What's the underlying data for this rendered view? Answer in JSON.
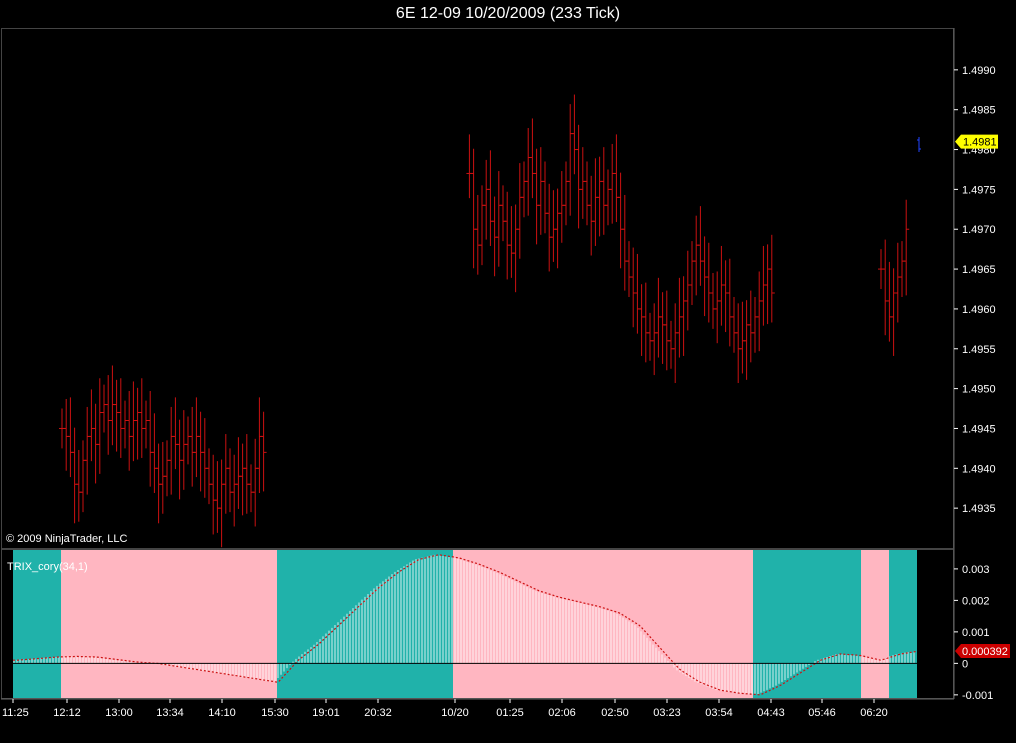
{
  "title": "6E 12-09  10/20/2009 (233 Tick)",
  "copyright": "© 2009 NinjaTrader, LLC",
  "indicator_label": "TRIX_cory(34,1)",
  "colors": {
    "background": "#000000",
    "price_bars": "#cc1111",
    "last_price_marker": "#ffff00",
    "trix_bars": "#ffffff",
    "trix_signal_line": "#cc1111",
    "zone_teal": "#20b2aa",
    "zone_pink": "#ffb6c1",
    "current_trix_marker": "#cc0000"
  },
  "chart_data": [
    {
      "type": "ohlc",
      "name": "price",
      "ylim": [
        1.493,
        1.4995
      ],
      "yticks": [
        "1.4935",
        "1.4940",
        "1.4945",
        "1.4950",
        "1.4955",
        "1.4960",
        "1.4965",
        "1.4970",
        "1.4975",
        "1.4980",
        "1.4985",
        "1.4990"
      ],
      "last_price": "1.4981",
      "segments": [
        {
          "start_bar": 0,
          "closes": [
            1.4945,
            1.4944,
            1.4942,
            1.4938,
            1.4937,
            1.4941,
            1.4944,
            1.4945,
            1.4943,
            1.4947,
            1.4948,
            1.4946,
            1.4948,
            1.4947,
            1.4945,
            1.4946,
            1.4944,
            1.4946,
            1.4947,
            1.4945,
            1.4946,
            1.4942,
            1.494,
            1.4938,
            1.4939,
            1.4941,
            1.4944,
            1.4943,
            1.4941,
            1.4943,
            1.4944,
            1.4942,
            1.4944,
            1.4942,
            1.494,
            1.4938,
            1.4936,
            1.4935,
            1.4938,
            1.494,
            1.4937,
            1.4938,
            1.4939,
            1.494,
            1.4938,
            1.4937,
            1.494,
            1.4944,
            1.4942
          ]
        },
        {
          "start_bar": 97,
          "closes": [
            1.4977,
            1.497,
            1.4968,
            1.4973,
            1.4975,
            1.4971,
            1.4969,
            1.4973,
            1.4971,
            1.4968,
            1.4967,
            1.497,
            1.4974,
            1.4976,
            1.4979,
            1.4977,
            1.4973,
            1.4976,
            1.4972,
            1.4969,
            1.497,
            1.4972,
            1.4973,
            1.4976,
            1.4982,
            1.498,
            1.4975,
            1.4976,
            1.4973,
            1.4971,
            1.4974,
            1.4976,
            1.4973,
            1.4975,
            1.4977,
            1.4974,
            1.497,
            1.4966,
            1.4964,
            1.4962,
            1.496,
            1.4959,
            1.4957,
            1.4956,
            1.4957,
            1.4959,
            1.4958,
            1.4956,
            1.4955,
            1.4957,
            1.4959,
            1.4961,
            1.4963,
            1.4966,
            1.4968,
            1.4966,
            1.4964,
            1.4962,
            1.496,
            1.4961,
            1.4963,
            1.4962,
            1.4959,
            1.4957,
            1.4955,
            1.4956,
            1.4958,
            1.4957,
            1.4959,
            1.4961,
            1.4963,
            1.4965,
            1.4962
          ]
        },
        {
          "start_bar": 195,
          "closes": [
            1.4965,
            1.4961,
            1.4959,
            1.4962,
            1.4964,
            1.4966,
            1.497
          ]
        }
      ]
    },
    {
      "type": "bar",
      "name": "TRIX_cory(34,1)",
      "ylim": [
        -0.0011,
        0.0036
      ],
      "yticks": [
        "-0.001",
        "0",
        "0.001",
        "0.002",
        "0.003"
      ],
      "current_value": "0.000392",
      "x_labels": [
        "11:25",
        "12:12",
        "13:00",
        "13:34",
        "14:10",
        "15:30",
        "19:01",
        "20:32",
        "10/20",
        "01:25",
        "02:06",
        "02:50",
        "03:23",
        "03:54",
        "04:43",
        "05:46",
        "06:20"
      ],
      "trix_values": [
        0.0001,
        0.00015,
        0.0002,
        0.00022,
        0.0002,
        0.00012,
        4e-05,
        0.0,
        -0.0001,
        -0.0002,
        -0.0003,
        -0.0004,
        -0.0005,
        -0.0006,
        0.0001,
        0.0006,
        0.0012,
        0.0018,
        0.0024,
        0.0029,
        0.0033,
        0.00345,
        0.00335,
        0.00315,
        0.0029,
        0.0026,
        0.0023,
        0.0021,
        0.00195,
        0.0018,
        0.0016,
        0.0012,
        0.0005,
        -0.0002,
        -0.0006,
        -0.00085,
        -0.00095,
        -0.001,
        -0.0007,
        -0.0003,
        0.0001,
        0.0003,
        0.00025,
        0.0001,
        0.0003,
        0.0004
      ],
      "zones": [
        {
          "color": "teal",
          "from_label": "11:25",
          "to_label": "12:12"
        },
        {
          "color": "pink",
          "from_label": "12:12",
          "to_label": "15:30"
        },
        {
          "color": "teal",
          "from_label": "15:30",
          "to_label": "10/20"
        },
        {
          "color": "pink",
          "from_label": "10/20",
          "to_label": "03:54"
        },
        {
          "color": "teal",
          "from_label": "03:54",
          "to_label": "06:20"
        },
        {
          "color": "pink",
          "from_label": "06:20",
          "to_label": "06:20"
        },
        {
          "color": "teal",
          "from_label": "06:20",
          "to_label": "end"
        }
      ]
    }
  ]
}
